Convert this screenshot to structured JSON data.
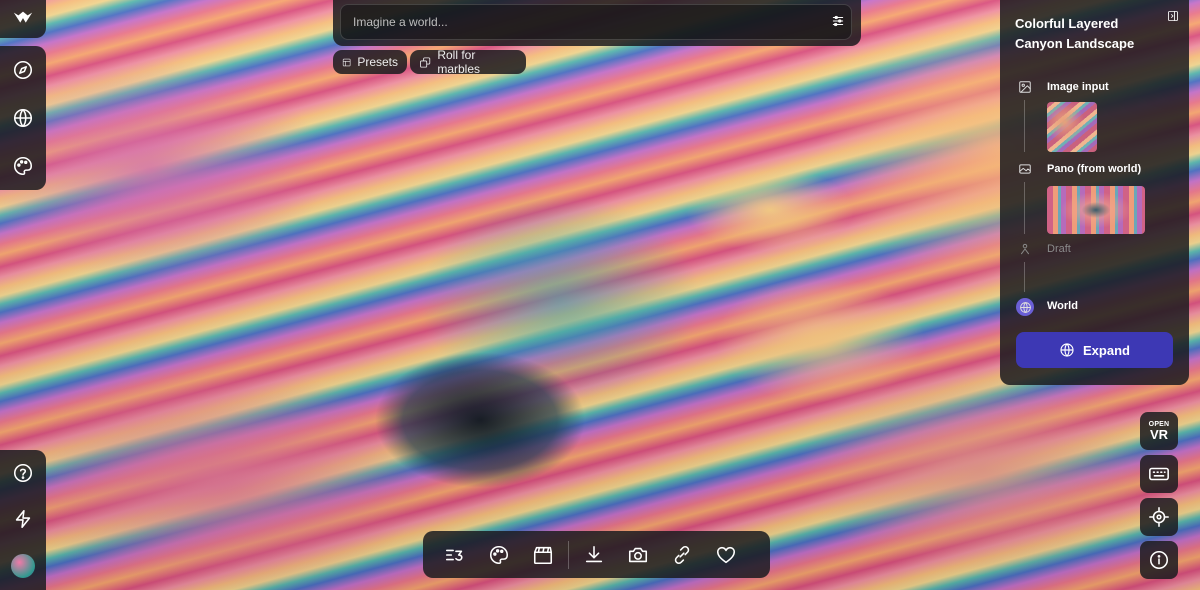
{
  "prompt": {
    "placeholder": "Imagine a world..."
  },
  "chips": {
    "presets_label": "Presets",
    "roll_label": "Roll for marbles"
  },
  "panel": {
    "title": "Colorful Layered Canyon Landscape",
    "steps": [
      {
        "label": "Image input",
        "icon": "image-icon"
      },
      {
        "label": "Pano (from world)",
        "icon": "panorama-icon"
      },
      {
        "label": "Draft",
        "icon": "person-icon"
      },
      {
        "label": "World",
        "icon": "globe-icon"
      }
    ],
    "expand_label": "Expand",
    "accent": "#3d38b4"
  },
  "vr": {
    "small": "OPEN",
    "big": "VR"
  },
  "left_nav": [
    "compass-icon",
    "globe-icon",
    "palette-icon"
  ],
  "left_bottom": [
    "help-icon",
    "lightning-icon",
    "avatar"
  ],
  "bottom_toolbar": [
    "timeline-icon",
    "palette-icon",
    "clapperboard-icon",
    "download-icon",
    "camera-icon",
    "link-icon",
    "heart-icon"
  ],
  "right_tools": [
    "vr-button",
    "keyboard-icon",
    "crosshair-icon",
    "info-icon"
  ]
}
